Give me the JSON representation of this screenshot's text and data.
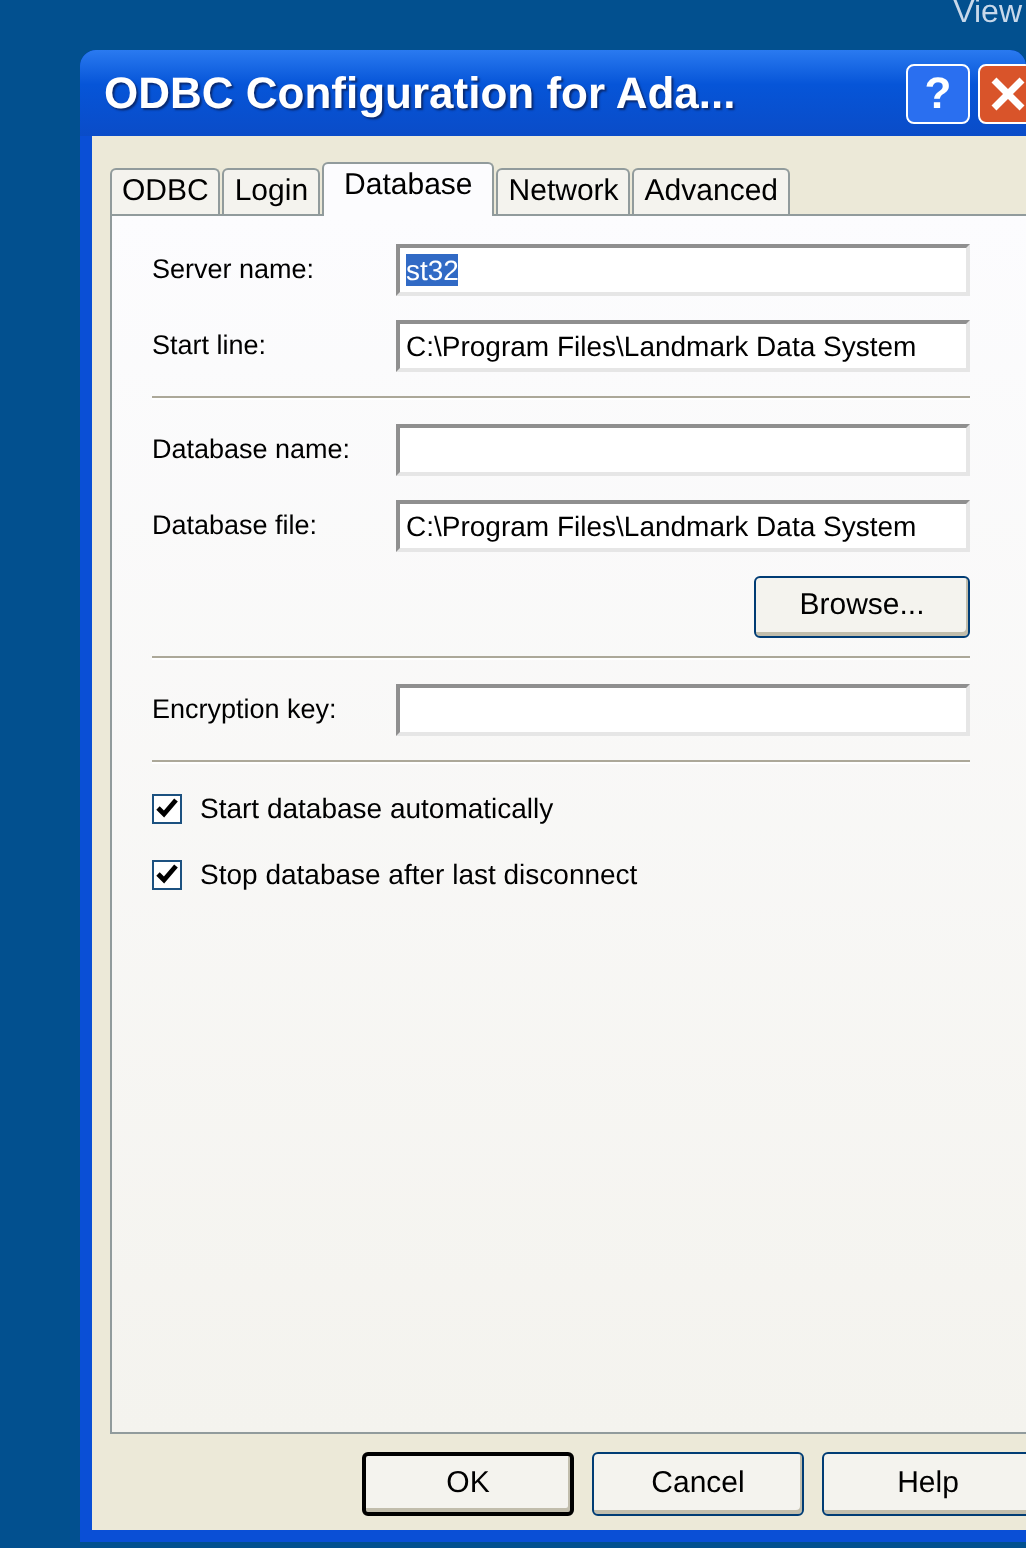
{
  "desktop": {
    "menu_text": "View"
  },
  "window": {
    "title": "ODBC Configuration for Ada...",
    "help_button": "?"
  },
  "tabs": [
    {
      "label": "ODBC",
      "selected": false
    },
    {
      "label": "Login",
      "selected": false
    },
    {
      "label": "Database",
      "selected": true
    },
    {
      "label": "Network",
      "selected": false
    },
    {
      "label": "Advanced",
      "selected": false
    }
  ],
  "groups": [
    {
      "fields": [
        {
          "label": "Server name:",
          "value": "st32",
          "value_selected": true
        },
        {
          "label": "Start line:",
          "value": "C:\\Program Files\\Landmark Data System",
          "value_selected": false
        }
      ]
    },
    {
      "fields": [
        {
          "label": "Database name:",
          "value_selected": false
        },
        {
          "label": "Database file:",
          "value": "C:\\Program Files\\Landmark Data System",
          "value_selected": false
        }
      ],
      "button": "Browse..."
    },
    {
      "fields": [
        {
          "label": "Encryption key:",
          "value_selected": false
        }
      ]
    }
  ],
  "checkboxes": [
    {
      "label": "Start database automatically",
      "checked": true
    },
    {
      "label": "Stop database after last disconnect",
      "checked": true
    }
  ],
  "buttons": [
    {
      "label": "OK",
      "default": true
    },
    {
      "label": "Cancel",
      "default": false
    },
    {
      "label": "Help",
      "default": false
    }
  ]
}
